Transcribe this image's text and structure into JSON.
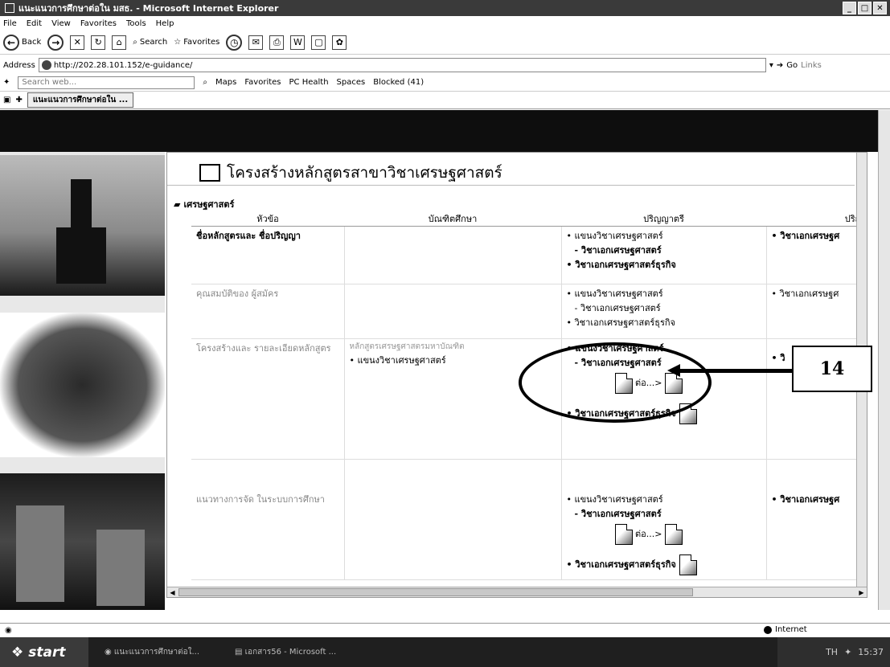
{
  "window": {
    "title": "แนะแนวการศึกษาต่อใน มสธ. - Microsoft Internet Explorer"
  },
  "menu": [
    "File",
    "Edit",
    "View",
    "Favorites",
    "Tools",
    "Help"
  ],
  "toolbar": {
    "back": "Back",
    "search": "Search",
    "favorites": "Favorites"
  },
  "address": {
    "label": "Address",
    "url": "http://202.28.101.152/e-guidance/",
    "go": "Go",
    "links": "Links"
  },
  "searchbar": {
    "placeholder": "Search web...",
    "items": [
      "Maps",
      "Favorites",
      "PC Health",
      "Spaces",
      "Blocked (41)"
    ]
  },
  "tab": {
    "label": "แนะแนวการศึกษาต่อใน ..."
  },
  "page": {
    "title": "โครงสร้างหลักสูตรสาขาวิชาเศรษฐศาสตร์",
    "section": "เศรษฐศาสตร์",
    "columns": [
      "หัวข้อ",
      "บัณฑิตศึกษา",
      "ปริญญาตรี",
      "ปริญ"
    ],
    "rows": [
      {
        "label": "ชื่อหลักสูตรและ ชื่อปริญญา",
        "bachelor": [
          "แขนงวิชาเศรษฐศาสตร์",
          "- วิชาเอกเศรษฐศาสตร์",
          "วิชาเอกเศรษฐศาสตร์ธุรกิจ"
        ],
        "next": "วิชาเอกเศรษฐศ"
      },
      {
        "label": "คุณสมบัติของ ผู้สมัคร",
        "bachelor": [
          "แขนงวิชาเศรษฐศาสตร์",
          "- วิชาเอกเศรษฐศาสตร์",
          "วิชาเอกเศรษฐศาสตร์ธุรกิจ"
        ],
        "next": "วิชาเอกเศรษฐศ"
      },
      {
        "label": "โครงสร้างและ รายละเอียดหลักสูตร",
        "graduate_gray": "หลักสูตรเศรษฐศาสตรมหาบัณฑิต",
        "graduate": "แขนงวิชาเศรษฐศาสตร์",
        "bachelor": [
          "แขนงวิชาเศรษฐศาสตร์",
          "- วิชาเอกเศรษฐศาสตร์",
          "วิชาเอกเศรษฐศาสตร์ธุรกิจ"
        ],
        "more": "ต่อ...>",
        "next": "วิ"
      },
      {
        "label": "แนวทางการจัด ในระบบการศึกษา",
        "bachelor": [
          "แขนงวิชาเศรษฐศาสตร์",
          "- วิชาเอกเศรษฐศาสตร์",
          "วิชาเอกเศรษฐศาสตร์ธุรกิจ"
        ],
        "more": "ต่อ...>",
        "next": "วิชาเอกเศรษฐศ"
      }
    ]
  },
  "annotation": {
    "number": "14"
  },
  "status": {
    "zone": "Internet"
  },
  "taskbar": {
    "start": "start",
    "tasks": [
      "แนะแนวการศึกษาต่อใ...",
      "เอกสาร56 - Microsoft ..."
    ],
    "lang": "TH",
    "clock": "15:37"
  }
}
